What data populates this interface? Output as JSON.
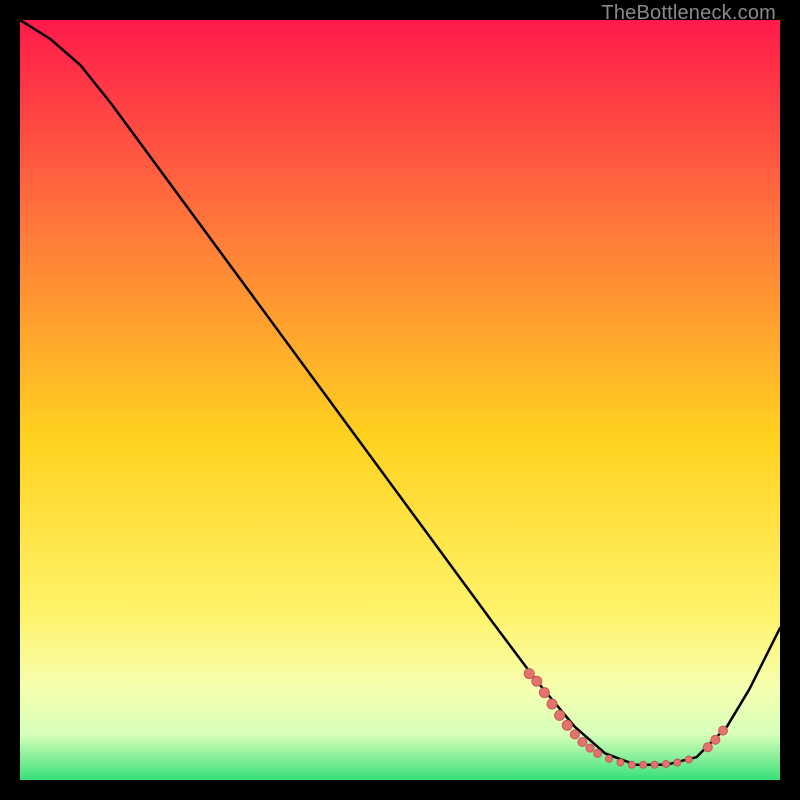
{
  "attribution": "TheBottleneck.com",
  "colors": {
    "gradient_top": "#ff1a4b",
    "gradient_mid_upper": "#ff7a3a",
    "gradient_mid": "#ffd21f",
    "gradient_mid_lower": "#fff36a",
    "gradient_low1": "#f6ffb0",
    "gradient_low2": "#d7ffb9",
    "gradient_bottom": "#38e07a",
    "curve": "#000000",
    "marker_fill": "#e4736f",
    "marker_stroke": "#c65a56",
    "frame_bg": "#000000"
  },
  "chart_data": {
    "type": "line",
    "title": "",
    "xlabel": "",
    "ylabel": "",
    "xlim": [
      0,
      100
    ],
    "ylim": [
      0,
      100
    ],
    "grid": false,
    "legend": false,
    "curve": [
      {
        "x": 0,
        "y": 100
      },
      {
        "x": 4,
        "y": 97.5
      },
      {
        "x": 8,
        "y": 94
      },
      {
        "x": 12,
        "y": 89
      },
      {
        "x": 62,
        "y": 21
      },
      {
        "x": 68,
        "y": 13
      },
      {
        "x": 73,
        "y": 7
      },
      {
        "x": 77,
        "y": 3.5
      },
      {
        "x": 81,
        "y": 2
      },
      {
        "x": 85,
        "y": 2
      },
      {
        "x": 89,
        "y": 3
      },
      {
        "x": 93,
        "y": 7
      },
      {
        "x": 96,
        "y": 12
      },
      {
        "x": 100,
        "y": 20
      }
    ],
    "markers": [
      {
        "x": 67,
        "y": 14,
        "r": 5
      },
      {
        "x": 68,
        "y": 13,
        "r": 5
      },
      {
        "x": 69,
        "y": 11.5,
        "r": 5
      },
      {
        "x": 70,
        "y": 10,
        "r": 5
      },
      {
        "x": 71,
        "y": 8.5,
        "r": 5
      },
      {
        "x": 72,
        "y": 7.2,
        "r": 5
      },
      {
        "x": 73,
        "y": 6,
        "r": 4.5
      },
      {
        "x": 74,
        "y": 5,
        "r": 4.5
      },
      {
        "x": 75,
        "y": 4.2,
        "r": 4
      },
      {
        "x": 76,
        "y": 3.5,
        "r": 4
      },
      {
        "x": 77.5,
        "y": 2.8,
        "r": 3.5
      },
      {
        "x": 79,
        "y": 2.3,
        "r": 3.5
      },
      {
        "x": 80.5,
        "y": 2,
        "r": 3.5
      },
      {
        "x": 82,
        "y": 2,
        "r": 3.5
      },
      {
        "x": 83.5,
        "y": 2,
        "r": 3.5
      },
      {
        "x": 85,
        "y": 2.1,
        "r": 3.5
      },
      {
        "x": 86.5,
        "y": 2.3,
        "r": 3.5
      },
      {
        "x": 88,
        "y": 2.7,
        "r": 3.5
      },
      {
        "x": 90.5,
        "y": 4.3,
        "r": 4.5
      },
      {
        "x": 91.5,
        "y": 5.3,
        "r": 4.5
      },
      {
        "x": 92.5,
        "y": 6.5,
        "r": 4.5
      }
    ]
  }
}
